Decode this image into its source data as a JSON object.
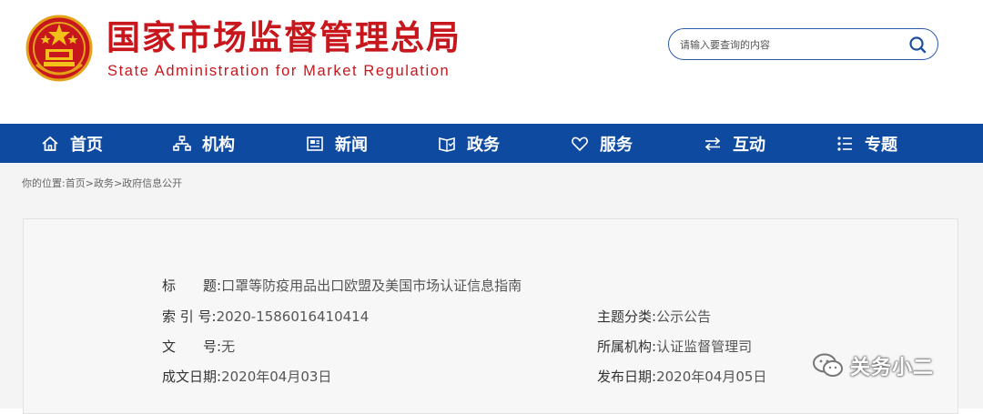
{
  "header": {
    "title_cn": "国家市场监督管理总局",
    "title_en": "State Administration for Market Regulation",
    "emblem_icon": "national-emblem-icon",
    "search_placeholder": "请输入要查询的内容",
    "brand_color": "#c8161d"
  },
  "nav": {
    "bg_color": "#0e4aa0",
    "items": [
      {
        "label": "首页",
        "icon": "home-icon"
      },
      {
        "label": "机构",
        "icon": "org-chart-icon"
      },
      {
        "label": "新闻",
        "icon": "newspaper-icon"
      },
      {
        "label": "政务",
        "icon": "book-icon"
      },
      {
        "label": "服务",
        "icon": "heart-icon"
      },
      {
        "label": "互动",
        "icon": "exchange-arrows-icon"
      },
      {
        "label": "专题",
        "icon": "list-icon"
      }
    ]
  },
  "breadcrumb": {
    "prefix": "你的位置:",
    "items": [
      "首页",
      "政务",
      "政府信息公开"
    ],
    "separator": ">"
  },
  "document": {
    "title_label": "标　　题:",
    "title_value": "口罩等防疫用品出口欧盟及美国市场认证信息指南",
    "index_label": "索 引 号:",
    "index_value": "2020-1586016410414",
    "doc_no_label": "文　　号:",
    "doc_no_value": "无",
    "date_created_label": "成文日期:",
    "date_created_value": "2020年04月03日",
    "category_label": "主题分类:",
    "category_value": "公示公告",
    "agency_label": "所属机构:",
    "agency_value": "认证监督管理司",
    "date_published_label": "发布日期:",
    "date_published_value": "2020年04月05日"
  },
  "watermark": {
    "text": "关务小二",
    "icon": "wechat-icon"
  }
}
